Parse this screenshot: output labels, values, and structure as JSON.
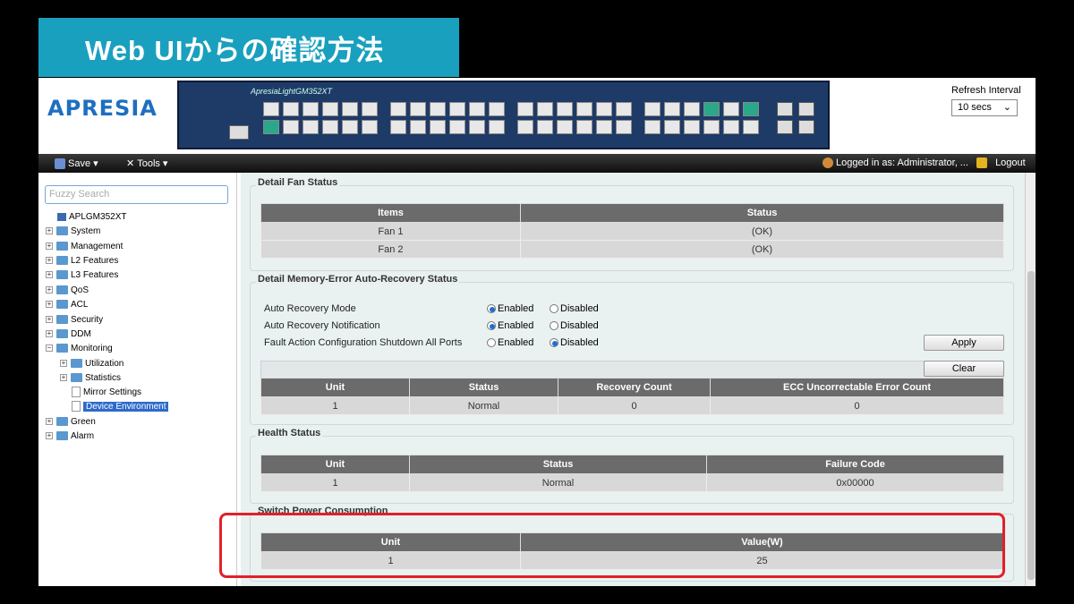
{
  "slide_title": "Web UIからの確認方法",
  "header": {
    "logo": "APRESIA",
    "panel_model": "ApresiaLightGM352XT",
    "refresh_label": "Refresh Interval",
    "refresh_value": "10 secs"
  },
  "menubar": {
    "save": "Save",
    "tools": "Tools",
    "logged_in": "Logged in as: Administrator, ...",
    "logout": "Logout"
  },
  "sidebar": {
    "search_placeholder": "Fuzzy Search",
    "root": "APLGM352XT",
    "items": [
      "System",
      "Management",
      "L2 Features",
      "L3 Features",
      "QoS",
      "ACL",
      "Security",
      "DDM",
      "Monitoring",
      "Green",
      "Alarm"
    ],
    "monitoring_children": [
      "Utilization",
      "Statistics",
      "Mirror Settings",
      "Device Environment"
    ]
  },
  "fan": {
    "title": "Detail Fan Status",
    "headers": [
      "Items",
      "Status"
    ],
    "rows": [
      [
        "Fan 1",
        "(OK)"
      ],
      [
        "Fan 2",
        "(OK)"
      ]
    ]
  },
  "memory": {
    "title": "Detail Memory-Error Auto-Recovery Status",
    "settings": [
      {
        "label": "Auto Recovery Mode",
        "enabled": true
      },
      {
        "label": "Auto Recovery Notification",
        "enabled": true
      },
      {
        "label": "Fault Action Configuration Shutdown All Ports",
        "enabled": false
      }
    ],
    "enabled_label": "Enabled",
    "disabled_label": "Disabled",
    "apply": "Apply",
    "clear": "Clear",
    "headers": [
      "Unit",
      "Status",
      "Recovery Count",
      "ECC Uncorrectable Error Count"
    ],
    "rows": [
      [
        "1",
        "Normal",
        "0",
        "0"
      ]
    ]
  },
  "health": {
    "title": "Health Status",
    "headers": [
      "Unit",
      "Status",
      "Failure Code"
    ],
    "rows": [
      [
        "1",
        "Normal",
        "0x00000"
      ]
    ]
  },
  "power": {
    "title": "Switch Power Consumption",
    "headers": [
      "Unit",
      "Value(W)"
    ],
    "rows": [
      [
        "1",
        "25"
      ]
    ]
  }
}
